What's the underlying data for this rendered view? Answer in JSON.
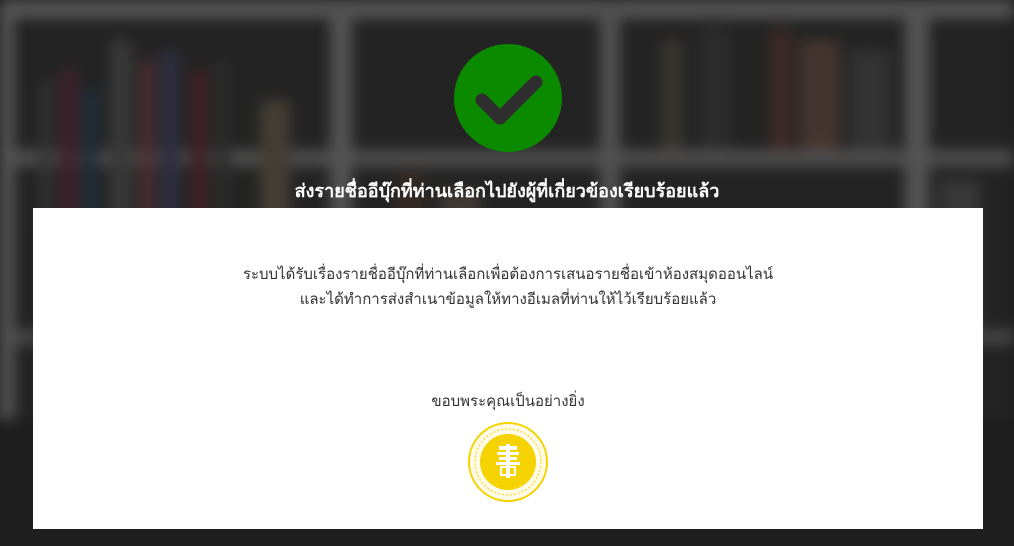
{
  "status": {
    "icon": "check-circle-icon",
    "icon_color": "#0b8a00",
    "headline": "ส่งรายชื่ออีบุ๊กที่ท่านเลือกไปยังผู้ที่เกี่ยวข้องเรียบร้อยแล้ว"
  },
  "card": {
    "message_line1": "ระบบได้รับเรื่องรายชื่ออีบุ๊กที่ท่านเลือกเพื่อต้องการเสนอรายชื่อเข้าห้องสมุดออนไลน์",
    "message_line2": "และได้ทำการส่งสำเนาข้อมูลให้ทางอีเมลที่ท่านให้ไว้เรียบร้อยแล้ว",
    "thanks": "ขอบพระคุณเป็นอย่างยิ่ง",
    "seal_icon": "library-seal-logo",
    "seal_color": "#f5d300"
  },
  "background": {
    "description_icon": "blurred-bookshelf-image"
  }
}
